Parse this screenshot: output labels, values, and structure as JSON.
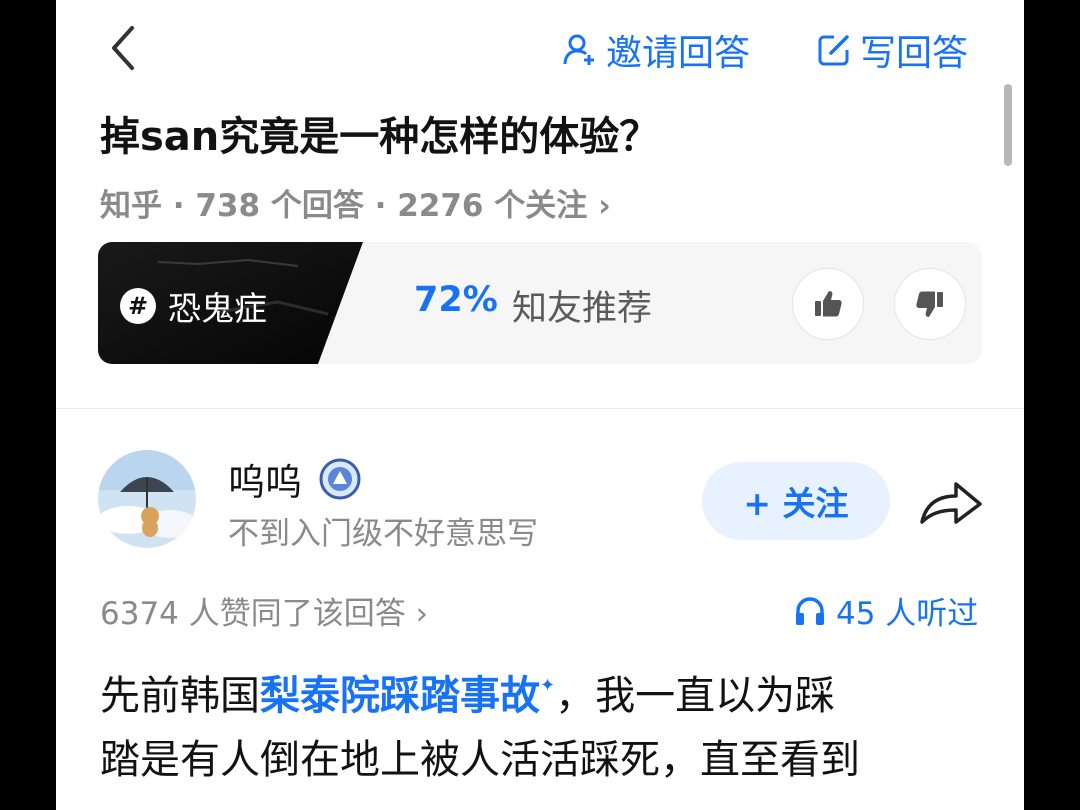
{
  "nav": {
    "invite_label": "邀请回答",
    "write_label": "写回答"
  },
  "question": {
    "title": "掉san究竟是一种怎样的体验？",
    "meta": "知乎 · 738 个回答 · 2276 个关注 ›"
  },
  "topic": {
    "name": "恐鬼症",
    "percent": "72%",
    "recommend": "知友推荐"
  },
  "answer": {
    "author": "呜呜",
    "bio": "不到入门级不好意思写",
    "follow_label": "+ 关注",
    "votes": "6374 人赞同了该回答 ›",
    "listened": "45 人听过",
    "line1_pre": "先前韩国",
    "line1_link": "梨泰院踩踏事故",
    "line1_post": "，我一直以为踩",
    "line2": "踏是有人倒在地上被人活活踩死，直至看到"
  },
  "colors": {
    "accent": "#1772f6",
    "text": "#121212",
    "muted": "#8a8a8a"
  }
}
